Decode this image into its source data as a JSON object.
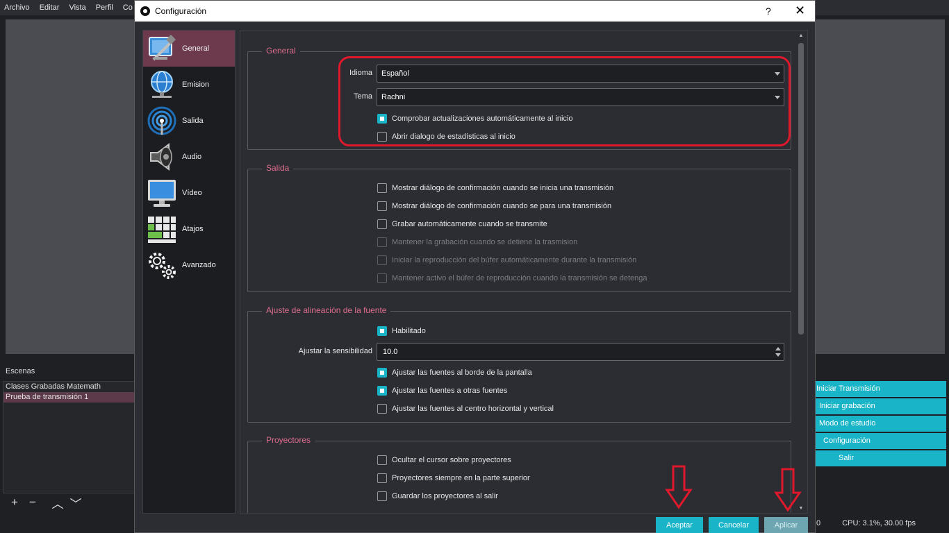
{
  "main_window": {
    "menu": [
      "Archivo",
      "Editar",
      "Vista",
      "Perfil",
      "Co"
    ],
    "scenes": {
      "title": "Escenas",
      "items": [
        "Clases Grabadas Matemath",
        "Prueba de transmisión 1"
      ],
      "selected_index": 1
    },
    "controls": [
      "Iniciar Transmisión",
      "Iniciar grabación",
      "Modo de estudio",
      "Configuración",
      "Salir"
    ],
    "status": {
      "left": "0",
      "cpu": "CPU: 3.1%, 30.00 fps"
    }
  },
  "dialog": {
    "title": "Configuración",
    "help": "?",
    "close": "✕",
    "nav": [
      {
        "label": "General",
        "icon": "general-icon",
        "active": true
      },
      {
        "label": "Emision",
        "icon": "globe-icon",
        "active": false
      },
      {
        "label": "Salida",
        "icon": "antenna-icon",
        "active": false
      },
      {
        "label": "Audio",
        "icon": "speaker-icon",
        "active": false
      },
      {
        "label": "Vídeo",
        "icon": "monitor-icon",
        "active": false
      },
      {
        "label": "Atajos",
        "icon": "keyboard-icon",
        "active": false
      },
      {
        "label": "Avanzado",
        "icon": "gears-icon",
        "active": false
      }
    ],
    "general": {
      "title": "General",
      "language_label": "Idioma",
      "language_value": "Español",
      "theme_label": "Tema",
      "theme_value": "Rachni",
      "check_updates": {
        "label": "Comprobar actualizaciones automáticamente al inicio",
        "checked": true
      },
      "stats_dialog": {
        "label": "Abrir dialogo de estadísticas al inicio",
        "checked": false
      }
    },
    "output": {
      "title": "Salida",
      "options": [
        {
          "label": "Mostrar diálogo de confirmación cuando se inicia una transmisión",
          "checked": false,
          "disabled": false
        },
        {
          "label": "Mostrar diálogo de confirmación cuando se para una transmisión",
          "checked": false,
          "disabled": false
        },
        {
          "label": "Grabar automáticamente cuando se transmite",
          "checked": false,
          "disabled": false
        },
        {
          "label": "Mantener la grabación cuando se detiene la trasmision",
          "checked": false,
          "disabled": true
        },
        {
          "label": "Iniciar la reproducción del búfer automáticamente durante la transmisión",
          "checked": false,
          "disabled": true
        },
        {
          "label": "Mantener activo el búfer de reproducción cuando la transmisión se detenga",
          "checked": false,
          "disabled": true
        }
      ]
    },
    "snapping": {
      "title": "Ajuste de alineación de la fuente",
      "enabled": {
        "label": "Habilitado",
        "checked": true
      },
      "sensitivity_label": "Ajustar la sensibilidad",
      "sensitivity_value": "10.0",
      "options": [
        {
          "label": "Ajustar las fuentes al borde de la pantalla",
          "checked": true
        },
        {
          "label": "Ajustar las fuentes a otras fuentes",
          "checked": true
        },
        {
          "label": "Ajustar las fuentes al centro horizontal y vertical",
          "checked": false
        }
      ]
    },
    "projectors": {
      "title": "Proyectores",
      "options": [
        {
          "label": "Ocultar el cursor sobre proyectores",
          "checked": false
        },
        {
          "label": "Proyectores siempre en la parte superior",
          "checked": false
        },
        {
          "label": "Guardar los proyectores al salir",
          "checked": false
        }
      ]
    },
    "buttons": {
      "accept": "Aceptar",
      "cancel": "Cancelar",
      "apply": "Aplicar"
    }
  },
  "colors": {
    "accent": "#1ab4c8",
    "section_title": "#e06c8c",
    "annotation_red": "#e0182c",
    "nav_active": "#6c3a4c"
  }
}
